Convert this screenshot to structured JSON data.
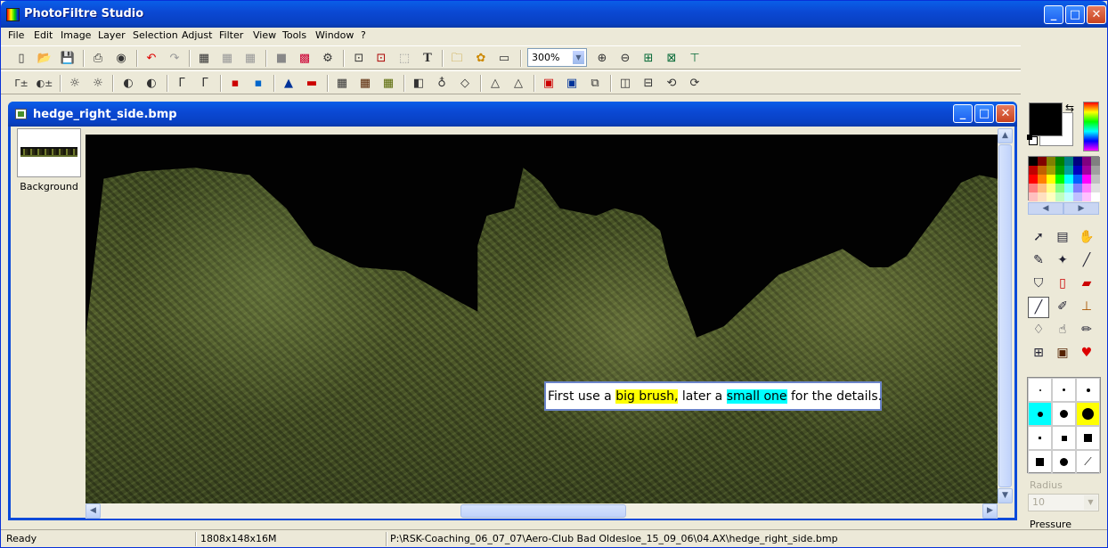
{
  "app": {
    "title": "PhotoFiltre Studio"
  },
  "menu": [
    "File",
    "Edit",
    "Image",
    "Layer",
    "Selection",
    "Adjust",
    "Filter",
    "View",
    "Tools",
    "Window",
    "?"
  ],
  "toolbar": {
    "zoom_value": "300%"
  },
  "document": {
    "title": "hedge_right_side.bmp",
    "layer_name": "Background"
  },
  "hint": {
    "part1": "First use a ",
    "highlight1": "big brush,",
    "part2": " later a ",
    "highlight2": "small one",
    "part3": " for the details."
  },
  "brush_options": {
    "radius_label": "Radius",
    "radius_value": "10",
    "pressure_label": "Pressure"
  },
  "status": {
    "state": "Ready",
    "image_info": "1808x148x16M",
    "file_path": "P:\\RSK-Coaching_06_07_07\\Aero-Club Bad Oldesloe_15_09_06\\04.AX\\hedge_right_side.bmp"
  },
  "colors": {
    "foreground": "#000000",
    "background": "#ffffff",
    "title_bar": "#0a5fe8",
    "highlight_yellow": "#ffff00",
    "highlight_cyan": "#00ffff"
  },
  "icons": {
    "window_controls": [
      "minimize-icon",
      "maximize-icon",
      "close-icon"
    ],
    "toolbar1": [
      "new-icon",
      "open-icon",
      "save-icon",
      "print-icon",
      "scan-icon",
      "undo-icon",
      "redo-icon",
      "copy-image-icon",
      "paste-image-icon",
      "paste-layer-icon",
      "color-fill-icon",
      "palette-icon",
      "automation-icon",
      "image-size-icon",
      "canvas-size-icon",
      "selection-icon",
      "text-icon",
      "explorer-icon",
      "settings-icon",
      "window-icon",
      "zoom-in-icon",
      "zoom-out-icon",
      "fit-window-icon",
      "actual-size-icon",
      "fullscreen-icon"
    ],
    "toolbar2": [
      "auto-levels-icon",
      "auto-contrast-icon",
      "brightness-minus-icon",
      "brightness-plus-icon",
      "contrast-minus-icon",
      "contrast-plus-icon",
      "gamma-minus-icon",
      "gamma-plus-icon",
      "saturation-minus-icon",
      "saturation-plus-icon",
      "histogram-icon",
      "color-balance-icon",
      "mosaic-icon",
      "pixelate-icon",
      "texture-icon",
      "blur-icon",
      "drop-icon",
      "sharpen-icon",
      "soften-icon",
      "more-sharpen-icon",
      "frame-icon",
      "shadow-icon",
      "transform-icon",
      "flip-h-icon",
      "flip-v-icon",
      "rotate-icon",
      "rotate-free-icon"
    ],
    "tools": [
      "pointer-icon",
      "select-icon",
      "hand-icon",
      "eyedropper-icon",
      "magic-wand-icon",
      "line-icon",
      "fill-icon",
      "spray-icon",
      "eraser-icon",
      "brush-icon",
      "clone-icon",
      "stamp-icon",
      "blur-drop-icon",
      "smudge-icon",
      "paint-tube-icon",
      "warp-icon",
      "portrait-icon",
      "strawberry-icon"
    ]
  }
}
